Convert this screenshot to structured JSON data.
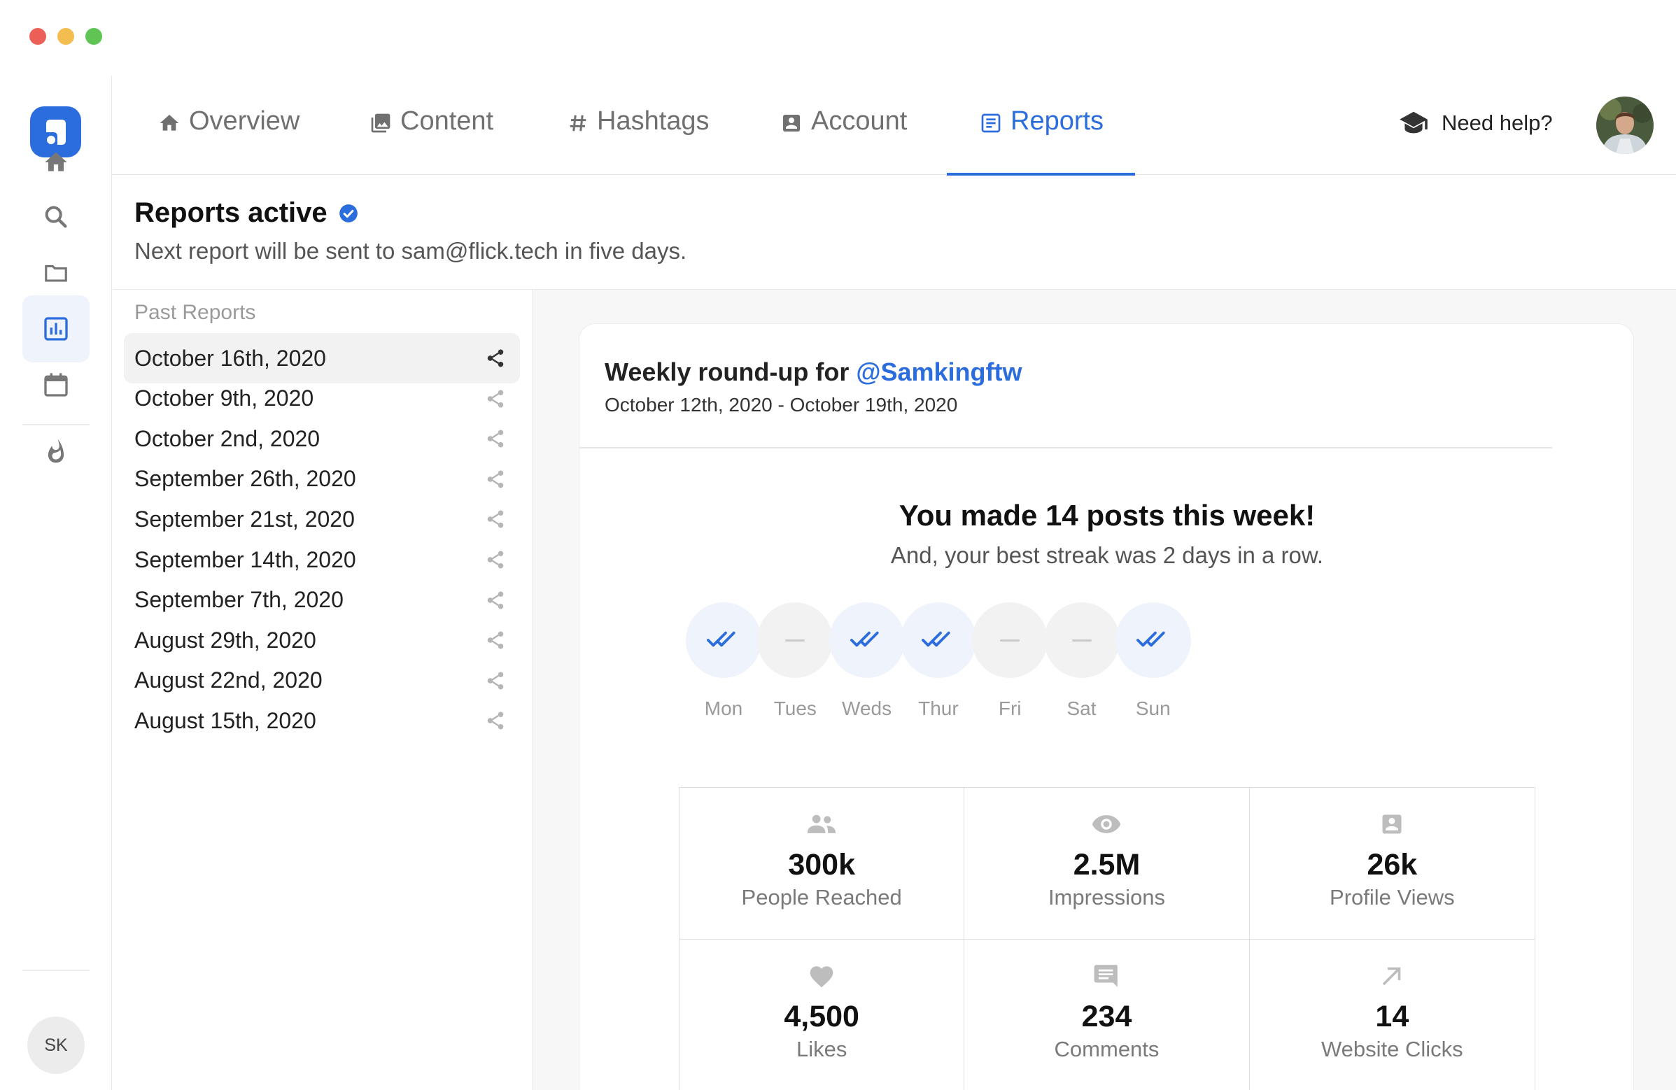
{
  "window": {
    "controls": [
      "#ec5f56",
      "#f4bd4f",
      "#5fc454"
    ]
  },
  "colors": {
    "accent": "#2c6ddd"
  },
  "sidebar": {
    "items": [
      {
        "icon": "home-icon"
      },
      {
        "icon": "search-icon"
      },
      {
        "icon": "folder-icon"
      },
      {
        "icon": "bar-chart-icon",
        "active": true
      },
      {
        "icon": "calendar-icon"
      },
      {
        "icon": "flame-icon"
      }
    ],
    "user_initials": "SK"
  },
  "nav": {
    "tabs": [
      {
        "label": "Overview",
        "icon": "home-icon"
      },
      {
        "label": "Content",
        "icon": "image-icon"
      },
      {
        "label": "Hashtags",
        "icon": "hash-icon"
      },
      {
        "label": "Account",
        "icon": "account-box-icon"
      },
      {
        "label": "Reports",
        "icon": "report-icon",
        "active": true
      }
    ],
    "help_label": "Need help?"
  },
  "header": {
    "title": "Reports active",
    "subtitle": "Next report will be sent to sam@flick.tech in five days."
  },
  "past_reports": {
    "title": "Past Reports",
    "items": [
      "October 16th, 2020",
      "October 9th, 2020",
      "October 2nd, 2020",
      "September 26th, 2020",
      "September 21st, 2020",
      "September 14th, 2020",
      "September 7th, 2020",
      "August 29th, 2020",
      "August 22nd, 2020",
      "August 15th, 2020"
    ]
  },
  "report": {
    "title_prefix": "Weekly round-up for",
    "handle": "@Samkingftw",
    "date_range": "October 12th, 2020 - October 19th, 2020",
    "headline": "You made 14 posts  this week!",
    "subline": "And, your best streak was 2 days in a row.",
    "days": [
      {
        "label": "Mon",
        "posted": true
      },
      {
        "label": "Tues",
        "posted": false
      },
      {
        "label": "Weds",
        "posted": true
      },
      {
        "label": "Thur",
        "posted": true
      },
      {
        "label": "Fri",
        "posted": false
      },
      {
        "label": "Sat",
        "posted": false
      },
      {
        "label": "Sun",
        "posted": true
      }
    ],
    "stats": [
      {
        "value": "300k",
        "label": "People Reached",
        "icon": "people-icon"
      },
      {
        "value": "2.5M",
        "label": "Impressions",
        "icon": "eye-icon"
      },
      {
        "value": "26k",
        "label": "Profile Views",
        "icon": "profile-icon"
      },
      {
        "value": "4,500",
        "label": "Likes",
        "icon": "heart-icon"
      },
      {
        "value": "234",
        "label": "Comments",
        "icon": "comment-icon"
      },
      {
        "value": "14",
        "label": "Website Clicks",
        "icon": "arrow-icon"
      }
    ]
  }
}
